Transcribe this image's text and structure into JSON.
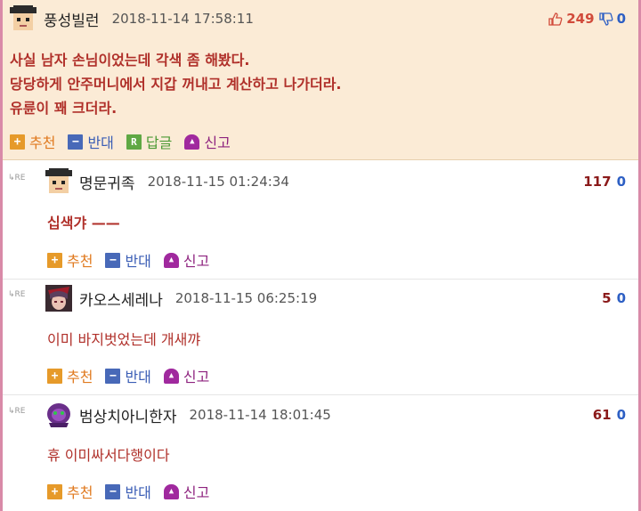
{
  "best_comment": {
    "nickname": "풍성빌런",
    "date": "2018-11-14 17:58:11",
    "up_votes": "249",
    "down_votes": "0",
    "lines": [
      "사실 남자 손님이었는데 각색 좀 해봤다.",
      "당당하게 안주머니에서 지갑 꺼내고 계산하고 나가더라.",
      "유륜이 꽤 크더라."
    ],
    "actions": {
      "recommend": "추천",
      "oppose": "반대",
      "reply": "답글",
      "report": "신고"
    }
  },
  "replies": [
    {
      "re": "RE",
      "nickname": "명문귀족",
      "date": "2018-11-15 01:24:34",
      "up_votes": "117",
      "down_votes": "0",
      "text": "십색갸 ——",
      "actions": {
        "recommend": "추천",
        "oppose": "반대",
        "report": "신고"
      }
    },
    {
      "re": "RE",
      "nickname": "카오스세레나",
      "date": "2018-11-15 06:25:19",
      "up_votes": "5",
      "down_votes": "0",
      "text": "이미 바지벗었는데 개새꺄",
      "actions": {
        "recommend": "추천",
        "oppose": "반대",
        "report": "신고"
      }
    },
    {
      "re": "RE",
      "nickname": "범상치아니한자",
      "date": "2018-11-14 18:01:45",
      "up_votes": "61",
      "down_votes": "0",
      "text": "휴 이미싸서다행이다",
      "actions": {
        "recommend": "추천",
        "oppose": "반대",
        "report": "신고"
      }
    }
  ],
  "colors": {
    "best_bg": "#fbebd6",
    "frame": "#d98aa8",
    "comment_text": "#b0302a",
    "recommend": "#e69a2a",
    "oppose": "#4869b8",
    "reply": "#5fa843",
    "report": "#a0299e"
  }
}
